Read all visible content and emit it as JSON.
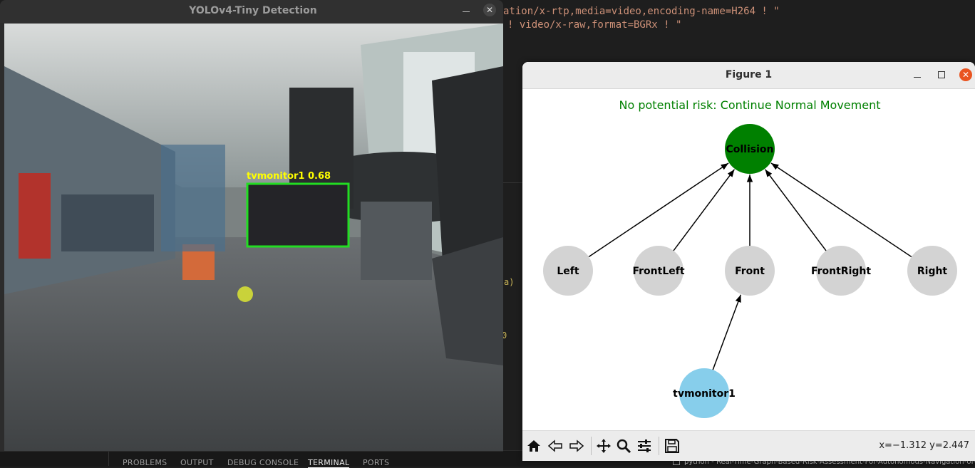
{
  "editor": {
    "code_line_1": "ation/x-rtp,media=video,encoding-name=H264 ! \"",
    "code_line_2": "! video/x-raw,format=BGRx ! \"",
    "fragment_1": "a)",
    "fragment_2": "0"
  },
  "bottom_panel": {
    "tabs": [
      "PROBLEMS",
      "OUTPUT",
      "DEBUG CONSOLE",
      "TERMINAL",
      "PORTS"
    ],
    "active_tab": "TERMINAL",
    "terminal_title": "python - Real-Time-Graph-Based-Risk-Assessment-For-Autonomous-Navigation-of-"
  },
  "yolo_window": {
    "title": "YOLOv4-Tiny Detection",
    "detection_label": "tvmonitor1  0.68",
    "colors": {
      "box": "#22dd22",
      "label": "#ffff00"
    }
  },
  "figure_window": {
    "title": "Figure 1",
    "status_text": "No potential risk: Continue Normal Movement",
    "status_color": "#008000",
    "nodes": [
      {
        "id": "collision",
        "label": "Collision",
        "color": "#008000"
      },
      {
        "id": "left",
        "label": "Left",
        "color": "#d3d3d3"
      },
      {
        "id": "frontleft",
        "label": "FrontLeft",
        "color": "#d3d3d3"
      },
      {
        "id": "front",
        "label": "Front",
        "color": "#d3d3d3"
      },
      {
        "id": "frontright",
        "label": "FrontRight",
        "color": "#d3d3d3"
      },
      {
        "id": "right",
        "label": "Right",
        "color": "#d3d3d3"
      },
      {
        "id": "tvmonitor1",
        "label": "tvmonitor1",
        "color": "#87ceeb"
      }
    ],
    "edges": [
      [
        "left",
        "collision"
      ],
      [
        "frontleft",
        "collision"
      ],
      [
        "front",
        "collision"
      ],
      [
        "frontright",
        "collision"
      ],
      [
        "right",
        "collision"
      ],
      [
        "tvmonitor1",
        "front"
      ]
    ],
    "toolbar": {
      "icons": [
        "home-icon",
        "back-icon",
        "forward-icon",
        "pan-icon",
        "zoom-icon",
        "configure-subplots-icon",
        "save-icon"
      ],
      "coords": "x=−1.312 y=2.447"
    }
  }
}
